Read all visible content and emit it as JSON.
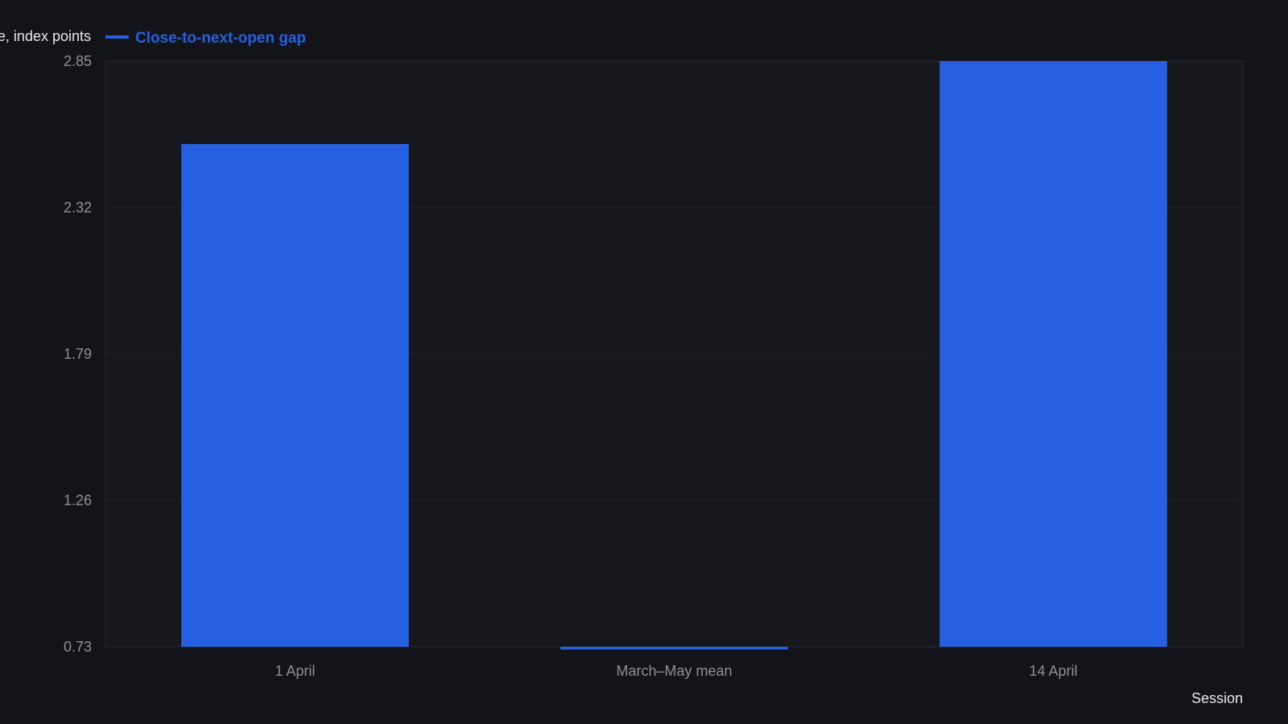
{
  "colors": {
    "background": "#121419",
    "plot_background": "#16181d",
    "series": "#265fdf",
    "grid": "#22252b",
    "axis_text": "#8d9096",
    "label_text": "#e6e7e9"
  },
  "chart_data": {
    "type": "bar",
    "categories": [
      "1 April",
      "March–May mean",
      "14 April"
    ],
    "series": [
      {
        "name": "Close-to-next-open gap",
        "values": [
          2.55,
          0.72,
          2.85
        ]
      }
    ],
    "yticks": [
      "0.73",
      "1.26",
      "1.79",
      "2.32",
      "2.85"
    ],
    "ylim": [
      0.73,
      2.85
    ],
    "ylabel": "e, index points",
    "xlabel": "Session",
    "legend_position": "top-left",
    "grid": true
  }
}
